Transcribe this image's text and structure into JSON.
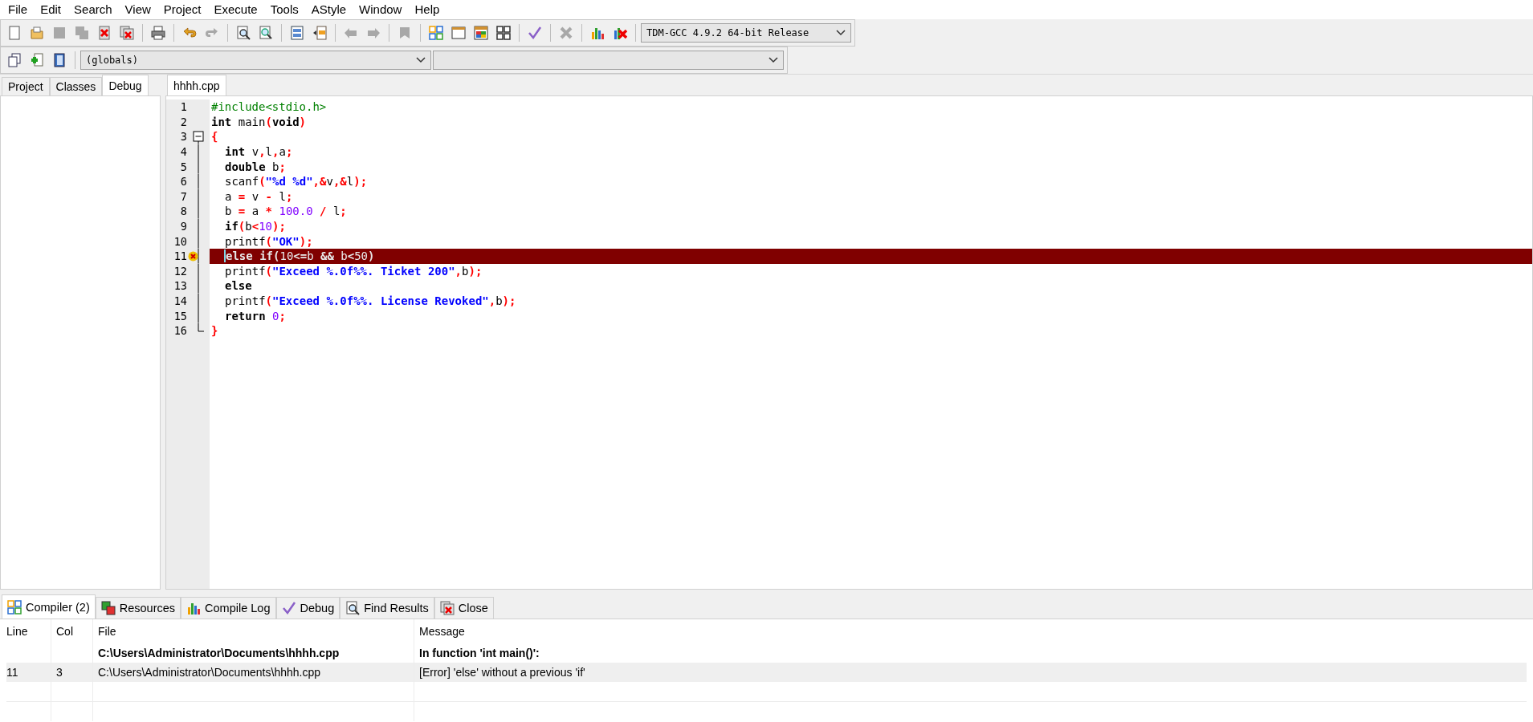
{
  "menu": [
    "File",
    "Edit",
    "Search",
    "View",
    "Project",
    "Execute",
    "Tools",
    "AStyle",
    "Window",
    "Help"
  ],
  "toolbar_main": {
    "groups": [
      [
        {
          "kind": "new",
          "disabled": false
        },
        {
          "kind": "open",
          "disabled": false
        },
        {
          "kind": "save",
          "disabled": true
        },
        {
          "kind": "saveall",
          "disabled": true
        },
        {
          "kind": "close",
          "disabled": false
        },
        {
          "kind": "closeall",
          "disabled": false
        }
      ],
      [
        {
          "kind": "print",
          "disabled": false
        }
      ],
      [
        {
          "kind": "undo",
          "disabled": false
        },
        {
          "kind": "redo",
          "disabled": true
        }
      ],
      [
        {
          "kind": "find",
          "disabled": false
        },
        {
          "kind": "replace",
          "disabled": false
        }
      ],
      [
        {
          "kind": "indent",
          "disabled": false
        },
        {
          "kind": "unindent",
          "disabled": false
        }
      ],
      [
        {
          "kind": "back",
          "disabled": true
        },
        {
          "kind": "forward",
          "disabled": true
        }
      ],
      [
        {
          "kind": "bookmark",
          "disabled": true
        }
      ],
      [
        {
          "kind": "compile",
          "disabled": false
        },
        {
          "kind": "run",
          "disabled": false
        },
        {
          "kind": "compilerun",
          "disabled": false
        },
        {
          "kind": "rebuild",
          "disabled": false
        }
      ],
      [
        {
          "kind": "check",
          "disabled": false
        }
      ],
      [
        {
          "kind": "stop",
          "disabled": true
        }
      ],
      [
        {
          "kind": "chart",
          "disabled": false
        },
        {
          "kind": "debugx",
          "disabled": false
        }
      ]
    ],
    "compiler": "TDM-GCC 4.9.2 64-bit Release"
  },
  "toolbar_secondary": {
    "buttons": [
      {
        "kind": "insert",
        "disabled": false
      },
      {
        "kind": "add",
        "disabled": false
      },
      {
        "kind": "book",
        "disabled": false
      }
    ],
    "scope": "(globals)"
  },
  "left_tabs": [
    {
      "label": "Project",
      "selected": false
    },
    {
      "label": "Classes",
      "selected": false
    },
    {
      "label": "Debug",
      "selected": true
    }
  ],
  "editor_tabs": [
    {
      "label": "hhhh.cpp",
      "selected": true
    }
  ],
  "code": [
    {
      "number": "1",
      "kind": "plain",
      "indented": false,
      "error": false,
      "cursor": false,
      "tokens": [
        {
          "kind": "pre",
          "t": "#include<stdio.h>"
        }
      ]
    },
    {
      "number": "2",
      "kind": "plain",
      "indented": false,
      "error": false,
      "cursor": false,
      "tokens": [
        {
          "kind": "kw",
          "t": "int"
        },
        {
          "kind": "id",
          "t": " main"
        },
        {
          "kind": "sym",
          "t": "("
        },
        {
          "kind": "kw",
          "t": "void"
        },
        {
          "kind": "sym",
          "t": ")"
        }
      ]
    },
    {
      "number": "3",
      "kind": "foldstart",
      "indented": false,
      "error": false,
      "cursor": false,
      "tokens": [
        {
          "kind": "sym",
          "t": "{"
        }
      ]
    },
    {
      "number": "4",
      "kind": "foldbody",
      "indented": true,
      "error": false,
      "cursor": false,
      "tokens": [
        {
          "kind": "kw",
          "t": "int"
        },
        {
          "kind": "id",
          "t": " v"
        },
        {
          "kind": "sym",
          "t": ","
        },
        {
          "kind": "id",
          "t": "l"
        },
        {
          "kind": "sym",
          "t": ","
        },
        {
          "kind": "id",
          "t": "a"
        },
        {
          "kind": "sym",
          "t": ";"
        }
      ]
    },
    {
      "number": "5",
      "kind": "foldbody",
      "indented": true,
      "error": false,
      "cursor": false,
      "tokens": [
        {
          "kind": "kw",
          "t": "double"
        },
        {
          "kind": "id",
          "t": " b"
        },
        {
          "kind": "sym",
          "t": ";"
        }
      ]
    },
    {
      "number": "6",
      "kind": "foldbody",
      "indented": true,
      "error": false,
      "cursor": false,
      "tokens": [
        {
          "kind": "id",
          "t": "scanf"
        },
        {
          "kind": "sym",
          "t": "("
        },
        {
          "kind": "str",
          "t": "\"%d %d\""
        },
        {
          "kind": "sym",
          "t": ",&"
        },
        {
          "kind": "id",
          "t": "v"
        },
        {
          "kind": "sym",
          "t": ",&"
        },
        {
          "kind": "id",
          "t": "l"
        },
        {
          "kind": "sym",
          "t": ");"
        }
      ]
    },
    {
      "number": "7",
      "kind": "foldbody",
      "indented": true,
      "error": false,
      "cursor": false,
      "tokens": [
        {
          "kind": "id",
          "t": "a "
        },
        {
          "kind": "sym",
          "t": "="
        },
        {
          "kind": "id",
          "t": " v "
        },
        {
          "kind": "sym",
          "t": "-"
        },
        {
          "kind": "id",
          "t": " l"
        },
        {
          "kind": "sym",
          "t": ";"
        }
      ]
    },
    {
      "number": "8",
      "kind": "foldbody",
      "indented": true,
      "error": false,
      "cursor": false,
      "tokens": [
        {
          "kind": "id",
          "t": "b "
        },
        {
          "kind": "sym",
          "t": "="
        },
        {
          "kind": "id",
          "t": " a "
        },
        {
          "kind": "sym",
          "t": "*"
        },
        {
          "kind": "num",
          "t": " 100.0"
        },
        {
          "kind": "sym",
          "t": " /"
        },
        {
          "kind": "id",
          "t": " l"
        },
        {
          "kind": "sym",
          "t": ";"
        }
      ]
    },
    {
      "number": "9",
      "kind": "foldbody",
      "indented": true,
      "error": false,
      "cursor": false,
      "tokens": [
        {
          "kind": "kw",
          "t": "if"
        },
        {
          "kind": "sym",
          "t": "("
        },
        {
          "kind": "id",
          "t": "b"
        },
        {
          "kind": "sym",
          "t": "<"
        },
        {
          "kind": "num",
          "t": "10"
        },
        {
          "kind": "sym",
          "t": ");"
        }
      ]
    },
    {
      "number": "10",
      "kind": "foldbody",
      "indented": true,
      "error": false,
      "cursor": false,
      "tokens": [
        {
          "kind": "id",
          "t": "printf"
        },
        {
          "kind": "sym",
          "t": "("
        },
        {
          "kind": "str",
          "t": "\"OK\""
        },
        {
          "kind": "sym",
          "t": ");"
        }
      ]
    },
    {
      "number": "11",
      "kind": "foldbody",
      "indented": true,
      "error": true,
      "cursor": true,
      "tokens": [
        {
          "kind": "kw",
          "t": "else"
        },
        {
          "kind": "kw",
          "t": " if"
        },
        {
          "kind": "sym",
          "t": "("
        },
        {
          "kind": "num",
          "t": "10"
        },
        {
          "kind": "sym",
          "t": "<="
        },
        {
          "kind": "id",
          "t": "b "
        },
        {
          "kind": "sym",
          "t": "&&"
        },
        {
          "kind": "id",
          "t": " b"
        },
        {
          "kind": "sym",
          "t": "<"
        },
        {
          "kind": "num",
          "t": "50"
        },
        {
          "kind": "sym",
          "t": ")"
        }
      ]
    },
    {
      "number": "12",
      "kind": "foldbody",
      "indented": true,
      "error": false,
      "cursor": false,
      "tokens": [
        {
          "kind": "id",
          "t": "printf"
        },
        {
          "kind": "sym",
          "t": "("
        },
        {
          "kind": "str",
          "t": "\"Exceed %.0f%%. Ticket 200\""
        },
        {
          "kind": "sym",
          "t": ","
        },
        {
          "kind": "id",
          "t": "b"
        },
        {
          "kind": "sym",
          "t": ");"
        }
      ]
    },
    {
      "number": "13",
      "kind": "foldbody",
      "indented": true,
      "error": false,
      "cursor": false,
      "tokens": [
        {
          "kind": "kw",
          "t": "else"
        }
      ]
    },
    {
      "number": "14",
      "kind": "foldbody",
      "indented": true,
      "error": false,
      "cursor": false,
      "tokens": [
        {
          "kind": "id",
          "t": "printf"
        },
        {
          "kind": "sym",
          "t": "("
        },
        {
          "kind": "str",
          "t": "\"Exceed %.0f%%. License Revoked\""
        },
        {
          "kind": "sym",
          "t": ","
        },
        {
          "kind": "id",
          "t": "b"
        },
        {
          "kind": "sym",
          "t": ");"
        }
      ]
    },
    {
      "number": "15",
      "kind": "foldbody",
      "indented": true,
      "error": false,
      "cursor": false,
      "tokens": [
        {
          "kind": "kw",
          "t": "return"
        },
        {
          "kind": "num",
          "t": " 0"
        },
        {
          "kind": "sym",
          "t": ";"
        }
      ]
    },
    {
      "number": "16",
      "kind": "foldend",
      "indented": false,
      "error": false,
      "cursor": false,
      "tokens": [
        {
          "kind": "sym",
          "t": "}"
        }
      ]
    }
  ],
  "bottom_tabs": [
    {
      "label": "Compiler (2)",
      "kind": "compile",
      "selected": true
    },
    {
      "label": "Resources",
      "kind": "resources",
      "selected": false
    },
    {
      "label": "Compile Log",
      "kind": "chart",
      "selected": false
    },
    {
      "label": "Debug",
      "kind": "check",
      "selected": false
    },
    {
      "label": "Find Results",
      "kind": "find",
      "selected": false
    },
    {
      "label": "Close",
      "kind": "closeall",
      "selected": false
    }
  ],
  "messages": {
    "columns": [
      "Line",
      "Col",
      "File",
      "Message"
    ],
    "rows": [
      {
        "kind": "context",
        "selected": false,
        "file": "C:\\Users\\Administrator\\Documents\\hhhh.cpp",
        "message": "In function 'int main()':"
      },
      {
        "kind": "error",
        "selected": true,
        "line": "11",
        "col": "3",
        "file": "C:\\Users\\Administrator\\Documents\\hhhh.cpp",
        "message": "[Error] 'else' without a previous 'if'"
      }
    ]
  }
}
